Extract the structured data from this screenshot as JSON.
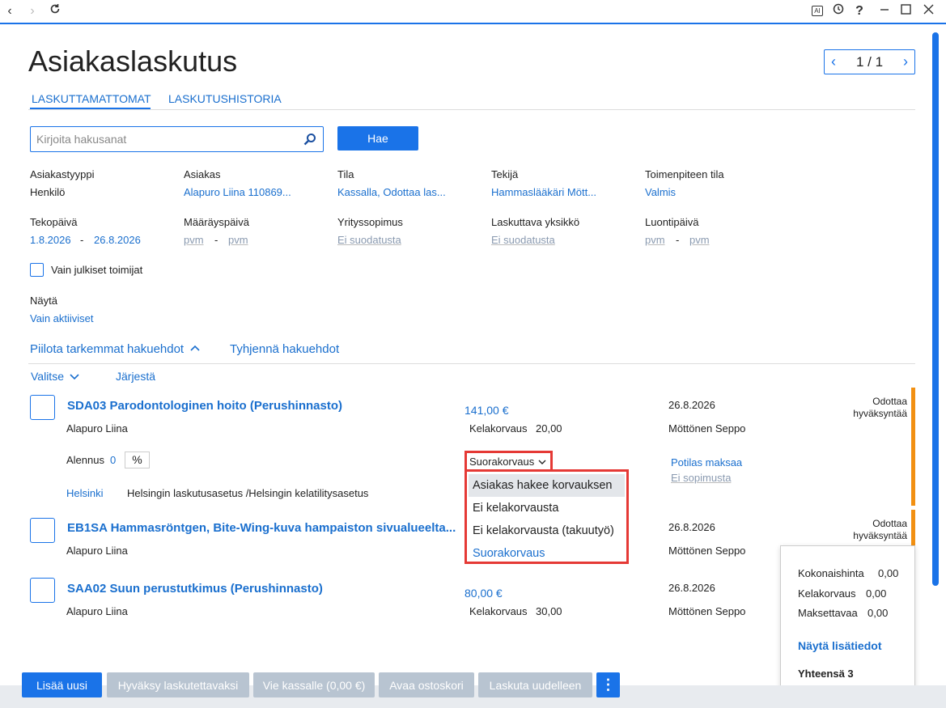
{
  "window": {
    "ai_icon_label": "AI",
    "help_label": "?"
  },
  "page": {
    "title": "Asiakaslaskutus",
    "pager": "1 / 1"
  },
  "tabs": [
    "LASKUTTAMATTOMAT",
    "LASKUTUSHISTORIA"
  ],
  "search": {
    "placeholder": "Kirjoita hakusanat",
    "button": "Hae"
  },
  "filters": {
    "asiakastyyppi": {
      "label": "Asiakastyyppi",
      "value": "Henkilö"
    },
    "asiakas": {
      "label": "Asiakas",
      "value": "Alapuro Liina 110869..."
    },
    "tila": {
      "label": "Tila",
      "value": "Kassalla, Odottaa las..."
    },
    "tekija": {
      "label": "Tekijä",
      "value": "Hammaslääkäri Mött..."
    },
    "toimenpiteen_tila": {
      "label": "Toimenpiteen tila",
      "value": "Valmis"
    },
    "tekopaiva": {
      "label": "Tekopäivä",
      "from": "1.8.2026",
      "sep": "-",
      "to": "26.8.2026"
    },
    "maarayspaiva": {
      "label": "Määräyspäivä",
      "from": "pvm",
      "sep": "-",
      "to": "pvm"
    },
    "yrityssopimus": {
      "label": "Yrityssopimus",
      "value": "Ei suodatusta"
    },
    "laskuttava_yksikko": {
      "label": "Laskuttava yksikkö",
      "value": "Ei suodatusta"
    },
    "luontipaiva": {
      "label": "Luontipäivä",
      "from": "pvm",
      "sep": "-",
      "to": "pvm"
    },
    "public_only": "Vain julkiset toimijat",
    "nayta": {
      "label": "Näytä",
      "value": "Vain aktiiviset"
    },
    "hide_advanced": "Piilota tarkemmat hakuehdot",
    "clear": "Tyhjennä hakuehdot"
  },
  "list_controls": {
    "select": "Valitse",
    "sort": "Järjestä"
  },
  "rows": [
    {
      "title": "SDA03  Parodontologinen hoito (Perushinnasto)",
      "patient": "Alapuro Liina",
      "price": "141,00 €",
      "kela_label": "Kelakorvaus",
      "kela_value": "20,00",
      "date": "26.8.2026",
      "doctor": "Möttönen Seppo",
      "status": "Odottaa hyväksyntää",
      "discount_label": "Alennus",
      "discount_value": "0",
      "discount_unit": "%",
      "compensation": "Suorakorvaus",
      "payer": "Potilas maksaa",
      "contract": "Ei sopimusta",
      "unit": "Helsinki",
      "settings": "Helsingin laskutusasetus /Helsingin kelatilitysasetus"
    },
    {
      "title": "EB1SA  Hammasröntgen, Bite-Wing-kuva hampaiston sivualueelta...",
      "patient": "Alapuro Liina",
      "date": "26.8.2026",
      "doctor": "Möttönen Seppo",
      "status": "Odottaa hyväksyntää"
    },
    {
      "title": "SAA02  Suun perustutkimus (Perushinnasto)",
      "patient": "Alapuro Liina",
      "price": "80,00 €",
      "kela_label": "Kelakorvaus",
      "kela_value": "30,00",
      "date": "26.8.2026",
      "doctor": "Möttönen Seppo"
    }
  ],
  "dropdown": {
    "options": [
      "Asiakas hakee korvauksen",
      "Ei kelakorvausta",
      "Ei kelakorvausta (takuutyö)",
      "Suorakorvaus"
    ],
    "highlighted": "Asiakas hakee korvauksen",
    "selected": "Suorakorvaus"
  },
  "summary": {
    "kokonaishinta_label": "Kokonaishinta",
    "kokonaishinta": "0,00",
    "kelakorvaus_label": "Kelakorvaus",
    "kelakorvaus": "0,00",
    "maksettavaa_label": "Maksettavaa",
    "maksettavaa": "0,00",
    "details_link": "Näytä lisätiedot",
    "total": "Yhteensä 3"
  },
  "actions": {
    "add_new": "Lisää uusi",
    "approve": "Hyväksy laskutettavaksi",
    "to_cashier": "Vie kassalle (0,00 €)",
    "open_cart": "Avaa ostoskori",
    "rebill": "Laskuta uudelleen",
    "more": "⋮"
  },
  "colors": {
    "accent": "#1a73e8",
    "link": "#1a6fce",
    "status_pending": "#f29012",
    "highlight_border": "#e53935",
    "disabled_button": "#b8c4d1"
  }
}
